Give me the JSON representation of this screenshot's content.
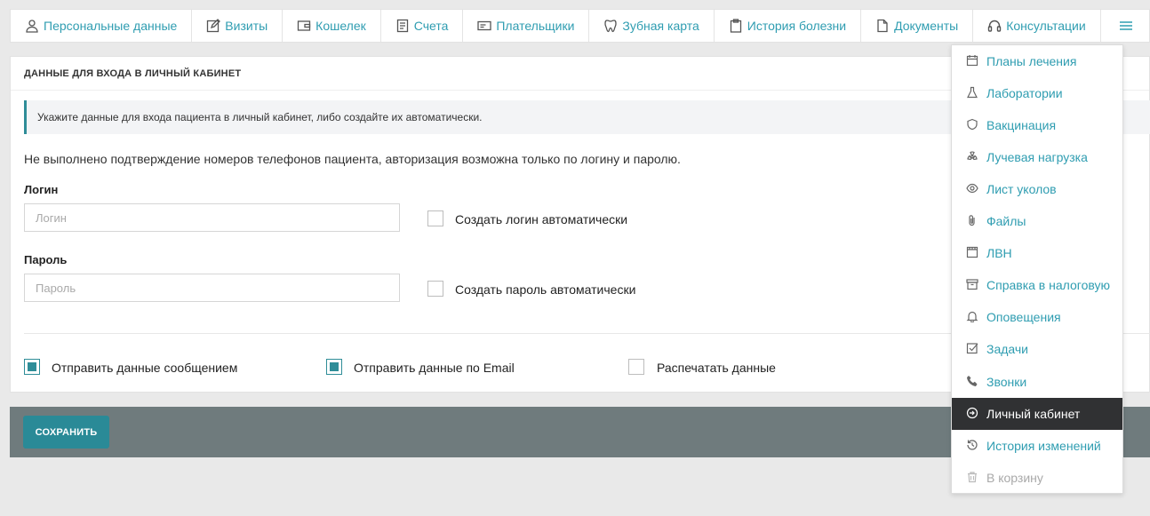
{
  "nav": {
    "tabs": [
      {
        "label": "Персональные данные",
        "icon": "person-icon"
      },
      {
        "label": "Визиты",
        "icon": "edit-icon"
      },
      {
        "label": "Кошелек",
        "icon": "wallet-icon"
      },
      {
        "label": "Счета",
        "icon": "invoice-icon"
      },
      {
        "label": "Плательщики",
        "icon": "card-icon"
      },
      {
        "label": "Зубная карта",
        "icon": "tooth-icon"
      },
      {
        "label": "История болезни",
        "icon": "clipboard-icon"
      },
      {
        "label": "Документы",
        "icon": "document-icon"
      },
      {
        "label": "Консультации",
        "icon": "headset-icon"
      }
    ],
    "menu_icon": "hamburger-icon"
  },
  "panel": {
    "title": "ДАННЫЕ ДЛЯ ВХОДА В ЛИЧНЫЙ КАБИНЕТ",
    "info": "Укажите данные для входа пациента в личный кабинет, либо создайте их автоматически.",
    "notice": "Не выполнено подтверждение номеров телефонов пациента, авторизация возможна только по логину и паролю.",
    "login": {
      "label": "Логин",
      "placeholder": "Логин",
      "value": "",
      "auto_label": "Создать логин автоматически",
      "auto_checked": false
    },
    "password": {
      "label": "Пароль",
      "placeholder": "Пароль",
      "value": "",
      "auto_label": "Создать пароль автоматически",
      "auto_checked": false
    },
    "options": [
      {
        "label": "Отправить данные сообщением",
        "checked": true
      },
      {
        "label": "Отправить данные по Email",
        "checked": true
      },
      {
        "label": "Распечатать данные",
        "checked": false
      }
    ]
  },
  "footer": {
    "save_label": "СОХРАНИТЬ"
  },
  "dropdown": {
    "items": [
      {
        "label": "Планы лечения",
        "icon": "calendar-icon",
        "state": "normal"
      },
      {
        "label": "Лаборатории",
        "icon": "flask-icon",
        "state": "normal"
      },
      {
        "label": "Вакцинация",
        "icon": "shield-icon",
        "state": "normal"
      },
      {
        "label": "Лучевая нагрузка",
        "icon": "radiation-icon",
        "state": "normal"
      },
      {
        "label": "Лист уколов",
        "icon": "eye-icon",
        "state": "normal"
      },
      {
        "label": "Файлы",
        "icon": "paperclip-icon",
        "state": "normal"
      },
      {
        "label": "ЛВН",
        "icon": "film-icon",
        "state": "normal"
      },
      {
        "label": "Справка в налоговую",
        "icon": "archive-icon",
        "state": "normal"
      },
      {
        "label": "Оповещения",
        "icon": "bell-icon",
        "state": "normal"
      },
      {
        "label": "Задачи",
        "icon": "checkbox-icon",
        "state": "normal"
      },
      {
        "label": "Звонки",
        "icon": "phone-icon",
        "state": "normal"
      },
      {
        "label": "Личный кабинет",
        "icon": "sign-in-icon",
        "state": "active"
      },
      {
        "label": "История изменений",
        "icon": "history-icon",
        "state": "normal"
      },
      {
        "label": "В корзину",
        "icon": "trash-icon",
        "state": "disabled"
      }
    ]
  },
  "colors": {
    "accent": "#2f9db1",
    "primary": "#2a8a97",
    "footer_bg": "#6f7b7d",
    "active_bg": "#303133"
  }
}
